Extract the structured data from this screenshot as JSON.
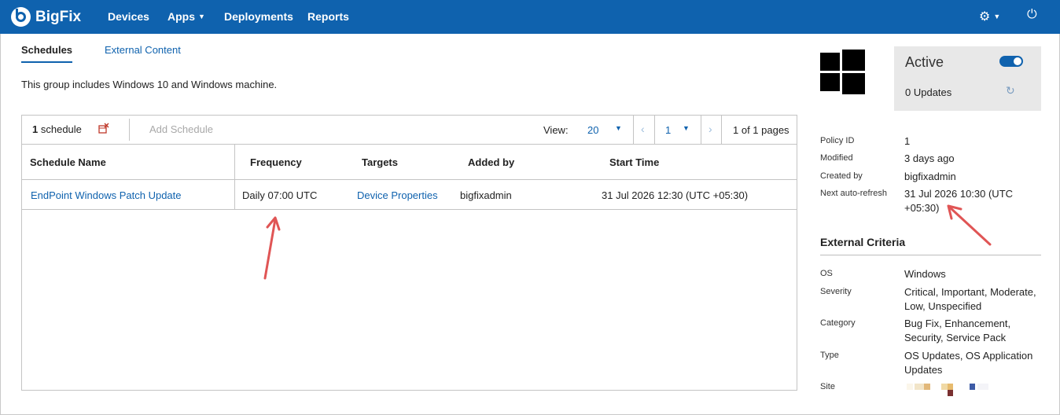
{
  "brand": {
    "name": "BigFix"
  },
  "nav": [
    {
      "label": "Devices"
    },
    {
      "label": "Apps",
      "has_menu": true
    },
    {
      "label": "Deployments"
    },
    {
      "label": "Reports"
    }
  ],
  "tabs": {
    "active": "Schedules",
    "other": "External Content"
  },
  "description": "This group includes Windows 10 and Windows machine.",
  "toolbar": {
    "count_number": "1",
    "count_label": "schedule",
    "add_label": "Add Schedule",
    "view_label": "View:",
    "view_value": "20",
    "page_value": "1",
    "page_of": "1 of 1 pages"
  },
  "table": {
    "columns": [
      "Schedule Name",
      "Frequency",
      "Targets",
      "Added by",
      "Start Time"
    ],
    "rows": [
      {
        "name": "EndPoint Windows Patch Update",
        "frequency": "Daily 07:00 UTC",
        "targets": "Device Properties",
        "added_by": "bigfixadmin",
        "start_time": "31 Jul 2026 12:30 (UTC +05:30)"
      }
    ]
  },
  "status": {
    "label": "Active",
    "enabled": true,
    "updates": "0 Updates"
  },
  "details": {
    "policy_id": {
      "key": "Policy ID",
      "value": "1"
    },
    "modified": {
      "key": "Modified",
      "value": "3 days ago"
    },
    "created_by": {
      "key": "Created by",
      "value": "bigfixadmin"
    },
    "next_refresh": {
      "key": "Next auto-refresh",
      "value": "31 Jul 2026 10:30 (UTC +05:30)"
    }
  },
  "external_criteria": {
    "title": "External Criteria",
    "os": {
      "key": "OS",
      "value": "Windows"
    },
    "severity": {
      "key": "Severity",
      "value": "Critical, Important, Moderate, Low, Unspecified"
    },
    "category": {
      "key": "Category",
      "value": "Bug Fix, Enhancement, Security, Service Pack"
    },
    "type": {
      "key": "Type",
      "value": "OS Updates, OS Application Updates"
    },
    "site": {
      "key": "Site"
    }
  },
  "colors": {
    "brand": "#0f62ae",
    "annotation_arrow": "#e05555"
  },
  "icons": [
    "settings-gear-icon",
    "power-icon",
    "delete-schedule-icon",
    "refresh-icon",
    "windows-logo-icon"
  ]
}
